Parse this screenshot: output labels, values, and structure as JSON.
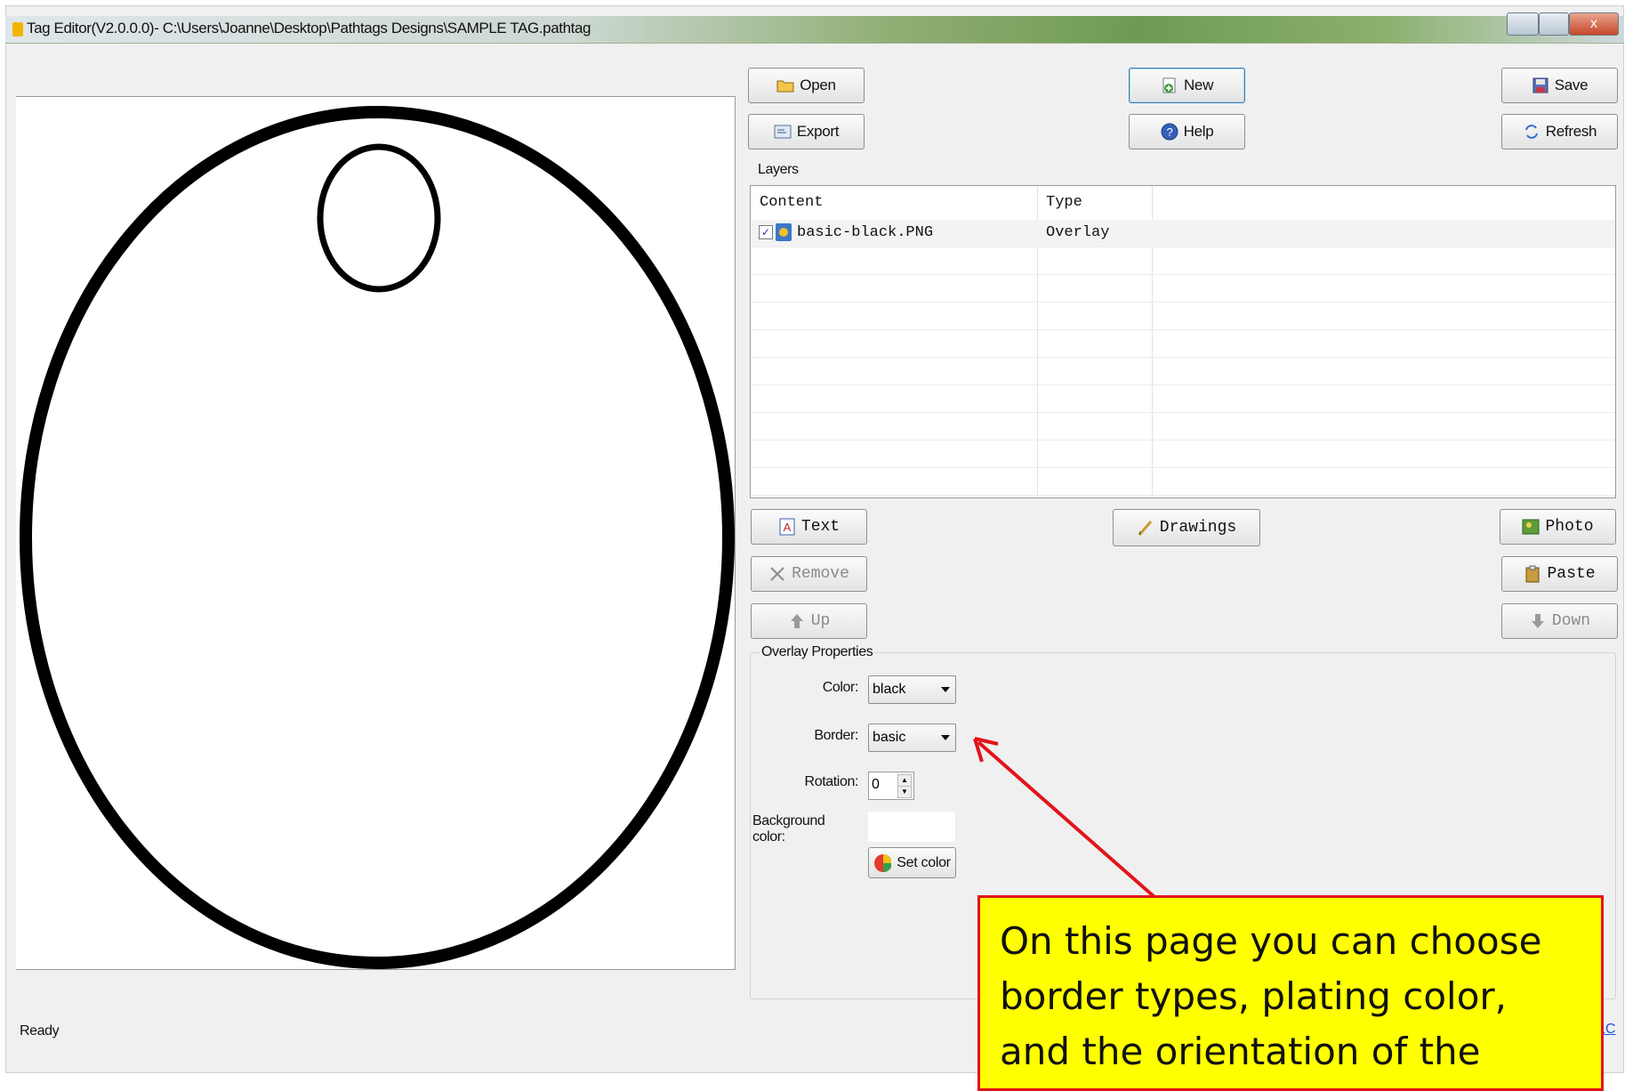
{
  "window": {
    "title": "Tag Editor(V2.0.0.0)- C:\\Users\\Joanne\\Desktop\\Pathtags Designs\\SAMPLE TAG.pathtag",
    "close_glyph": "x"
  },
  "toolbar": {
    "open_label": "Open",
    "new_label": "New",
    "save_label": "Save",
    "export_label": "Export",
    "help_label": "Help",
    "refresh_label": "Refresh"
  },
  "layers": {
    "group_label": "Layers",
    "columns": [
      "Content",
      "Type"
    ],
    "rows": [
      {
        "checked": true,
        "content": "basic-black.PNG",
        "type": "Overlay"
      }
    ]
  },
  "layer_actions": {
    "text_label": "Text",
    "drawings_label": "Drawings",
    "photo_label": "Photo",
    "remove_label": "Remove",
    "paste_label": "Paste",
    "up_label": "Up",
    "down_label": "Down"
  },
  "overlay_properties": {
    "group_label": "Overlay Properties",
    "color_label": "Color:",
    "color_value": "black",
    "border_label": "Border:",
    "border_value": "basic",
    "rotation_label": "Rotation:",
    "rotation_value": "0",
    "background_color_label": "Background color:",
    "set_color_label": "Set color"
  },
  "status": {
    "text": "Ready",
    "link_text": "LC"
  },
  "callout": {
    "text": "On this page you can choose border types, plating color, and the orientation of the"
  },
  "colors": {
    "window_bg": "#f0f0f0",
    "callout_bg": "#ffff00",
    "callout_border": "#e2141a",
    "arrow": "#e2141a",
    "tag_outline": "#000000"
  }
}
